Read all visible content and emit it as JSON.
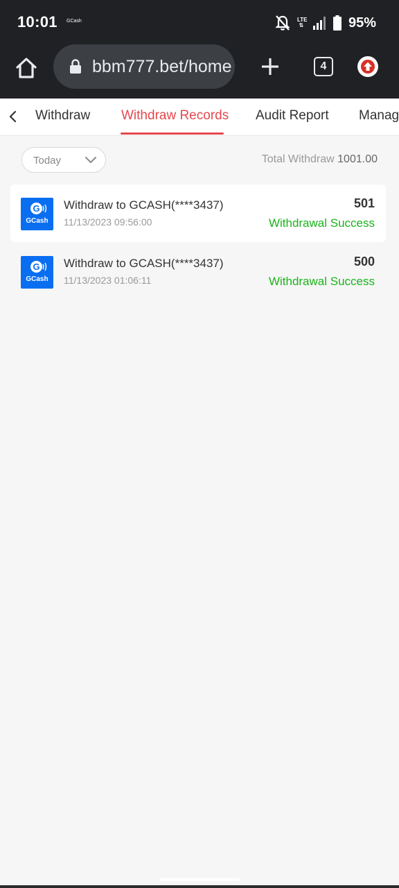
{
  "status_bar": {
    "time": "10:01",
    "notification_label": "GCash",
    "network_label": "LTE",
    "battery": "95%",
    "icons": [
      "bell-off-icon",
      "lte-icon",
      "signal-icon",
      "battery-icon"
    ]
  },
  "browser": {
    "url": "bbm777.bet/home",
    "tab_count": "4",
    "icons": [
      "home-icon",
      "lock-icon",
      "plus-icon",
      "update-icon"
    ]
  },
  "tabs": {
    "items": [
      {
        "label": "Withdraw"
      },
      {
        "label": "Withdraw Records"
      },
      {
        "label": "Audit Report"
      },
      {
        "label": "Management"
      }
    ],
    "active": "Withdraw Records",
    "accent_color": "#e5484d"
  },
  "filter": {
    "date_label": "Today",
    "total_label": "Total Withdraw",
    "total_value": "1001.00"
  },
  "records": [
    {
      "logo_text": "GCash",
      "logo_letter": "G",
      "title": "Withdraw to GCASH(****3437)",
      "time": "11/13/2023 09:56:00",
      "amount": "501",
      "status": "Withdrawal Success"
    },
    {
      "logo_text": "GCash",
      "logo_letter": "G",
      "title": "Withdraw to GCASH(****3437)",
      "time": "11/13/2023 01:06:11",
      "amount": "500",
      "status": "Withdrawal Success"
    }
  ],
  "colors": {
    "success": "#1ab31a",
    "gcash_blue": "#0a6ef0"
  }
}
